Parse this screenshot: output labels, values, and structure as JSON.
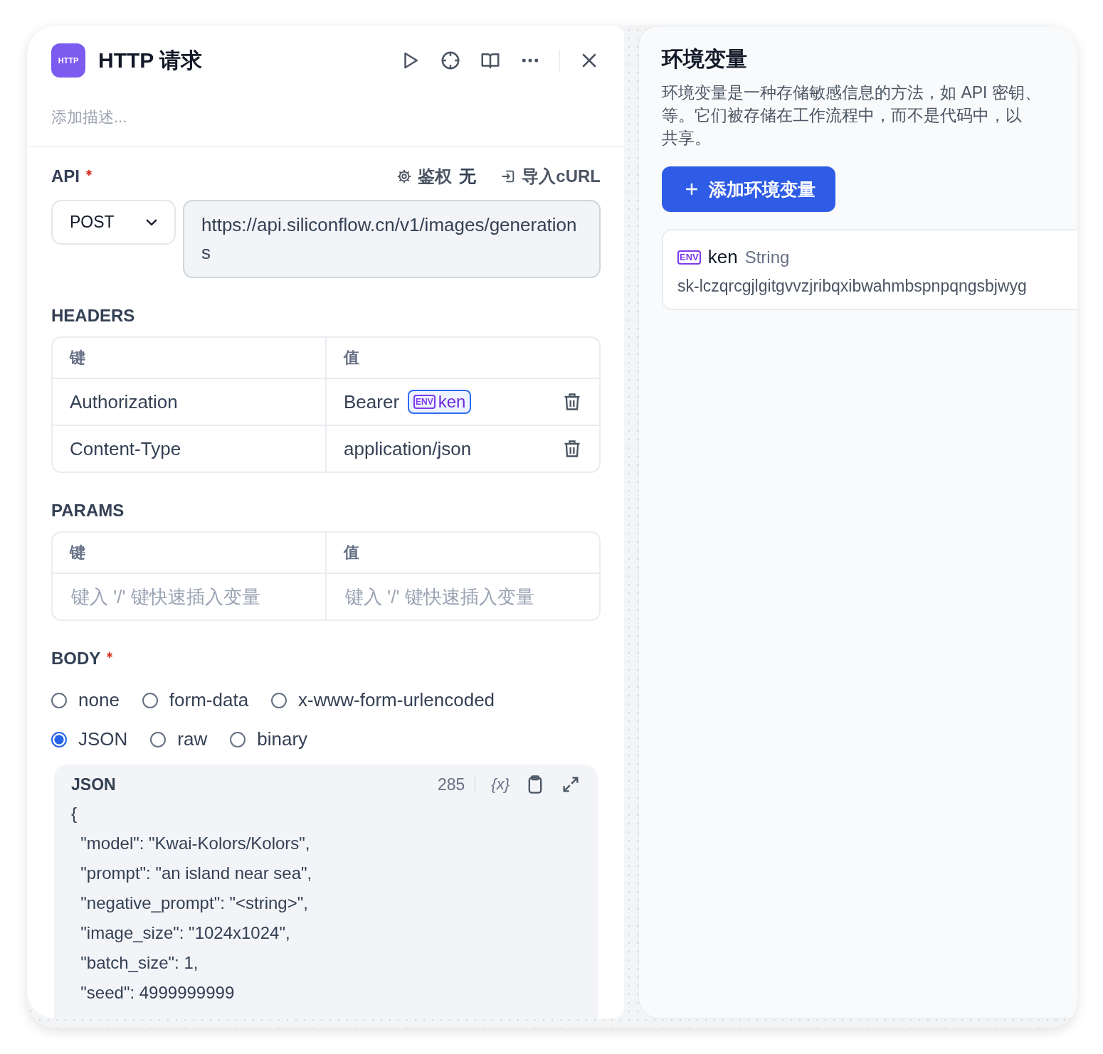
{
  "node": {
    "icon_label": "HTTP",
    "title": "HTTP 请求",
    "description_placeholder": "添加描述..."
  },
  "api": {
    "label": "API",
    "required": true,
    "auth_label": "鉴权",
    "auth_value": "无",
    "import_label": "导入cURL",
    "method": "POST",
    "url": "https://api.siliconflow.cn/v1/images/generations"
  },
  "headers": {
    "label": "HEADERS",
    "columns": [
      "键",
      "值"
    ],
    "rows": [
      {
        "key": "Authorization",
        "value": "Bearer",
        "variable": {
          "badge": "ENV",
          "name": "ken"
        }
      },
      {
        "key": "Content-Type",
        "value": "application/json"
      }
    ]
  },
  "params": {
    "label": "PARAMS",
    "columns": [
      "键",
      "值"
    ],
    "key_placeholder": "键入 '/' 键快速插入变量",
    "value_placeholder": "键入 '/' 键快速插入变量"
  },
  "body": {
    "label": "BODY",
    "required": true,
    "options": [
      {
        "label": "none",
        "selected": false
      },
      {
        "label": "form-data",
        "selected": false
      },
      {
        "label": "x-www-form-urlencoded",
        "selected": false
      },
      {
        "label": "JSON",
        "selected": true
      },
      {
        "label": "raw",
        "selected": false
      },
      {
        "label": "binary",
        "selected": false
      }
    ],
    "editor": {
      "title": "JSON",
      "char_count": "285",
      "variable_button": "{x}",
      "lines": [
        "{",
        "  \"model\": \"Kwai-Kolors/Kolors\",",
        "  \"prompt\": \"an island near sea\",",
        "  \"negative_prompt\": \"<string>\",",
        "  \"image_size\": \"1024x1024\",",
        "  \"batch_size\": 1,",
        "  \"seed\": 4999999999"
      ]
    }
  },
  "env_panel": {
    "title": "环境变量",
    "description_lines": [
      "环境变量是一种存储敏感信息的方法，如 API 密钥、",
      "等。它们被存储在工作流程中，而不是代码中，以",
      "共享。"
    ],
    "add_button": "添加环境变量",
    "variables": [
      {
        "badge": "ENV",
        "name": "ken",
        "type": "String",
        "value": "sk-lczqrcgjlgitgvvzjribqxibwahmbspnpqngsbjwyg"
      }
    ]
  }
}
